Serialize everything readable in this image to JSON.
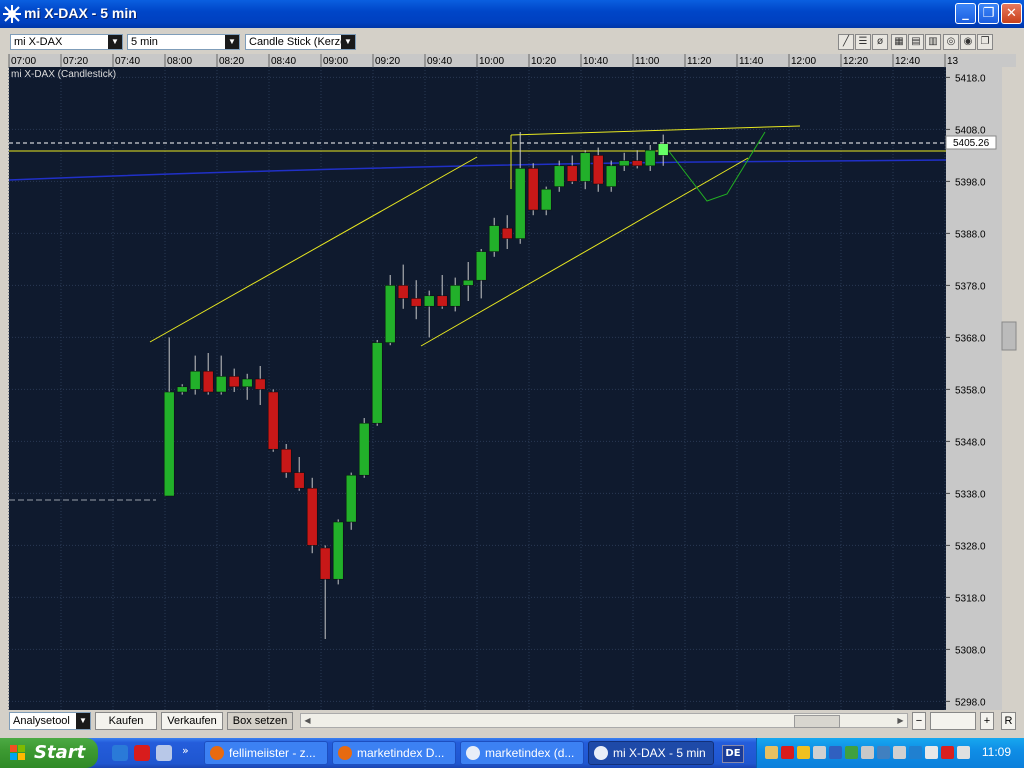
{
  "window": {
    "title": "mi X-DAX - 5 min"
  },
  "toolbar": {
    "symbol": "mi X-DAX",
    "interval": "5 min",
    "chart_type": "Candle Stick (Kerze"
  },
  "chart_data": {
    "type": "candlestick",
    "title": "mi X-DAX (Candlestick)",
    "time_labels": [
      "07:00",
      "07:20",
      "07:40",
      "08:00",
      "08:20",
      "08:40",
      "09:00",
      "09:20",
      "09:40",
      "10:00",
      "10:20",
      "10:40",
      "11:00",
      "11:20",
      "11:40",
      "12:00",
      "12:20",
      "12:40",
      "13"
    ],
    "ylim": [
      5295,
      5422
    ],
    "y_ticks": [
      "5418.0",
      "5408.0",
      "5398.0",
      "5388.0",
      "5378.0",
      "5368.0",
      "5358.0",
      "5348.0",
      "5338.0",
      "5328.0",
      "5318.0",
      "5308.0",
      "5298.0"
    ],
    "current_price": "5405.26",
    "previous_close": 5337.5,
    "ohlc": [
      {
        "time": "08:00",
        "open": 5337.5,
        "high": 5368.0,
        "low": 5337.5,
        "close": 5357.5
      },
      {
        "time": "08:05",
        "open": 5357.5,
        "high": 5359.0,
        "low": 5357.0,
        "close": 5358.5
      },
      {
        "time": "08:10",
        "open": 5358.0,
        "high": 5364.5,
        "low": 5357.0,
        "close": 5361.5
      },
      {
        "time": "08:15",
        "open": 5361.5,
        "high": 5365.0,
        "low": 5357.0,
        "close": 5357.5
      },
      {
        "time": "08:20",
        "open": 5357.5,
        "high": 5364.5,
        "low": 5357.0,
        "close": 5360.5
      },
      {
        "time": "08:25",
        "open": 5360.5,
        "high": 5362.0,
        "low": 5357.5,
        "close": 5358.5
      },
      {
        "time": "08:30",
        "open": 5358.5,
        "high": 5361.0,
        "low": 5356.0,
        "close": 5360.0
      },
      {
        "time": "08:35",
        "open": 5360.0,
        "high": 5362.5,
        "low": 5355.0,
        "close": 5358.0
      },
      {
        "time": "08:40",
        "open": 5357.5,
        "high": 5358.0,
        "low": 5346.0,
        "close": 5346.5
      },
      {
        "time": "08:45",
        "open": 5346.5,
        "high": 5347.5,
        "low": 5341.0,
        "close": 5342.0
      },
      {
        "time": "08:50",
        "open": 5342.0,
        "high": 5345.0,
        "low": 5338.5,
        "close": 5339.0
      },
      {
        "time": "08:55",
        "open": 5339.0,
        "high": 5341.0,
        "low": 5326.5,
        "close": 5328.0
      },
      {
        "time": "09:00",
        "open": 5327.5,
        "high": 5328.0,
        "low": 5310.0,
        "close": 5321.5
      },
      {
        "time": "09:05",
        "open": 5321.5,
        "high": 5333.0,
        "low": 5320.5,
        "close": 5332.5
      },
      {
        "time": "09:10",
        "open": 5332.5,
        "high": 5342.0,
        "low": 5331.0,
        "close": 5341.5
      },
      {
        "time": "09:15",
        "open": 5341.5,
        "high": 5352.5,
        "low": 5341.0,
        "close": 5351.5
      },
      {
        "time": "09:20",
        "open": 5351.5,
        "high": 5367.5,
        "low": 5351.0,
        "close": 5367.0
      },
      {
        "time": "09:25",
        "open": 5367.0,
        "high": 5380.0,
        "low": 5366.5,
        "close": 5378.0
      },
      {
        "time": "09:30",
        "open": 5378.0,
        "high": 5382.0,
        "low": 5373.5,
        "close": 5375.5
      },
      {
        "time": "09:35",
        "open": 5375.5,
        "high": 5379.0,
        "low": 5371.5,
        "close": 5374.0
      },
      {
        "time": "09:40",
        "open": 5374.0,
        "high": 5377.0,
        "low": 5368.0,
        "close": 5376.0
      },
      {
        "time": "09:45",
        "open": 5376.0,
        "high": 5380.0,
        "low": 5373.5,
        "close": 5374.0
      },
      {
        "time": "09:50",
        "open": 5374.0,
        "high": 5379.5,
        "low": 5373.0,
        "close": 5378.0
      },
      {
        "time": "09:55",
        "open": 5378.0,
        "high": 5382.5,
        "low": 5375.0,
        "close": 5379.0
      },
      {
        "time": "10:00",
        "open": 5379.0,
        "high": 5385.0,
        "low": 5375.5,
        "close": 5384.5
      },
      {
        "time": "10:05",
        "open": 5384.5,
        "high": 5391.0,
        "low": 5383.5,
        "close": 5389.5
      },
      {
        "time": "10:10",
        "open": 5389.0,
        "high": 5391.5,
        "low": 5385.0,
        "close": 5387.0
      },
      {
        "time": "10:15",
        "open": 5387.0,
        "high": 5407.5,
        "low": 5386.0,
        "close": 5400.5
      },
      {
        "time": "10:20",
        "open": 5400.5,
        "high": 5401.5,
        "low": 5391.5,
        "close": 5392.5
      },
      {
        "time": "10:25",
        "open": 5392.5,
        "high": 5397.0,
        "low": 5391.5,
        "close": 5396.5
      },
      {
        "time": "10:30",
        "open": 5397.0,
        "high": 5402.0,
        "low": 5396.0,
        "close": 5401.0
      },
      {
        "time": "10:35",
        "open": 5401.0,
        "high": 5403.0,
        "low": 5397.5,
        "close": 5398.0
      },
      {
        "time": "10:40",
        "open": 5398.0,
        "high": 5404.0,
        "low": 5396.5,
        "close": 5403.5
      },
      {
        "time": "10:45",
        "open": 5403.0,
        "high": 5404.5,
        "low": 5396.0,
        "close": 5397.5
      },
      {
        "time": "10:50",
        "open": 5397.0,
        "high": 5402.0,
        "low": 5396.0,
        "close": 5401.0
      },
      {
        "time": "10:55",
        "open": 5401.0,
        "high": 5403.5,
        "low": 5400.0,
        "close": 5402.0
      },
      {
        "time": "11:00",
        "open": 5402.0,
        "high": 5404.0,
        "low": 5400.5,
        "close": 5401.0
      },
      {
        "time": "11:05",
        "open": 5401.0,
        "high": 5405.0,
        "low": 5400.0,
        "close": 5404.0
      },
      {
        "time": "11:10",
        "open": 5403.0,
        "high": 5407.0,
        "low": 5401.0,
        "close": 5405.26
      }
    ],
    "colors": {
      "background": "#0f1a2e",
      "grid": "#2a3954",
      "up": "#22b02a",
      "down": "#c81818",
      "last": "#66ff66",
      "trendline": "#e8e820",
      "forecast": "#22b022",
      "moving_average": "#2030c8"
    }
  },
  "bottom": {
    "analysis_tool": "Analysetool",
    "buy": "Kaufen",
    "sell": "Verkaufen",
    "set_box": "Box setzen",
    "reset": "R"
  },
  "taskbar": {
    "start": "Start",
    "tasks": [
      "fellimeiister - z...",
      "marketindex D...",
      "marketindex (d...",
      "mi X-DAX - 5 min"
    ],
    "language": "DE",
    "clock": "11:09"
  }
}
